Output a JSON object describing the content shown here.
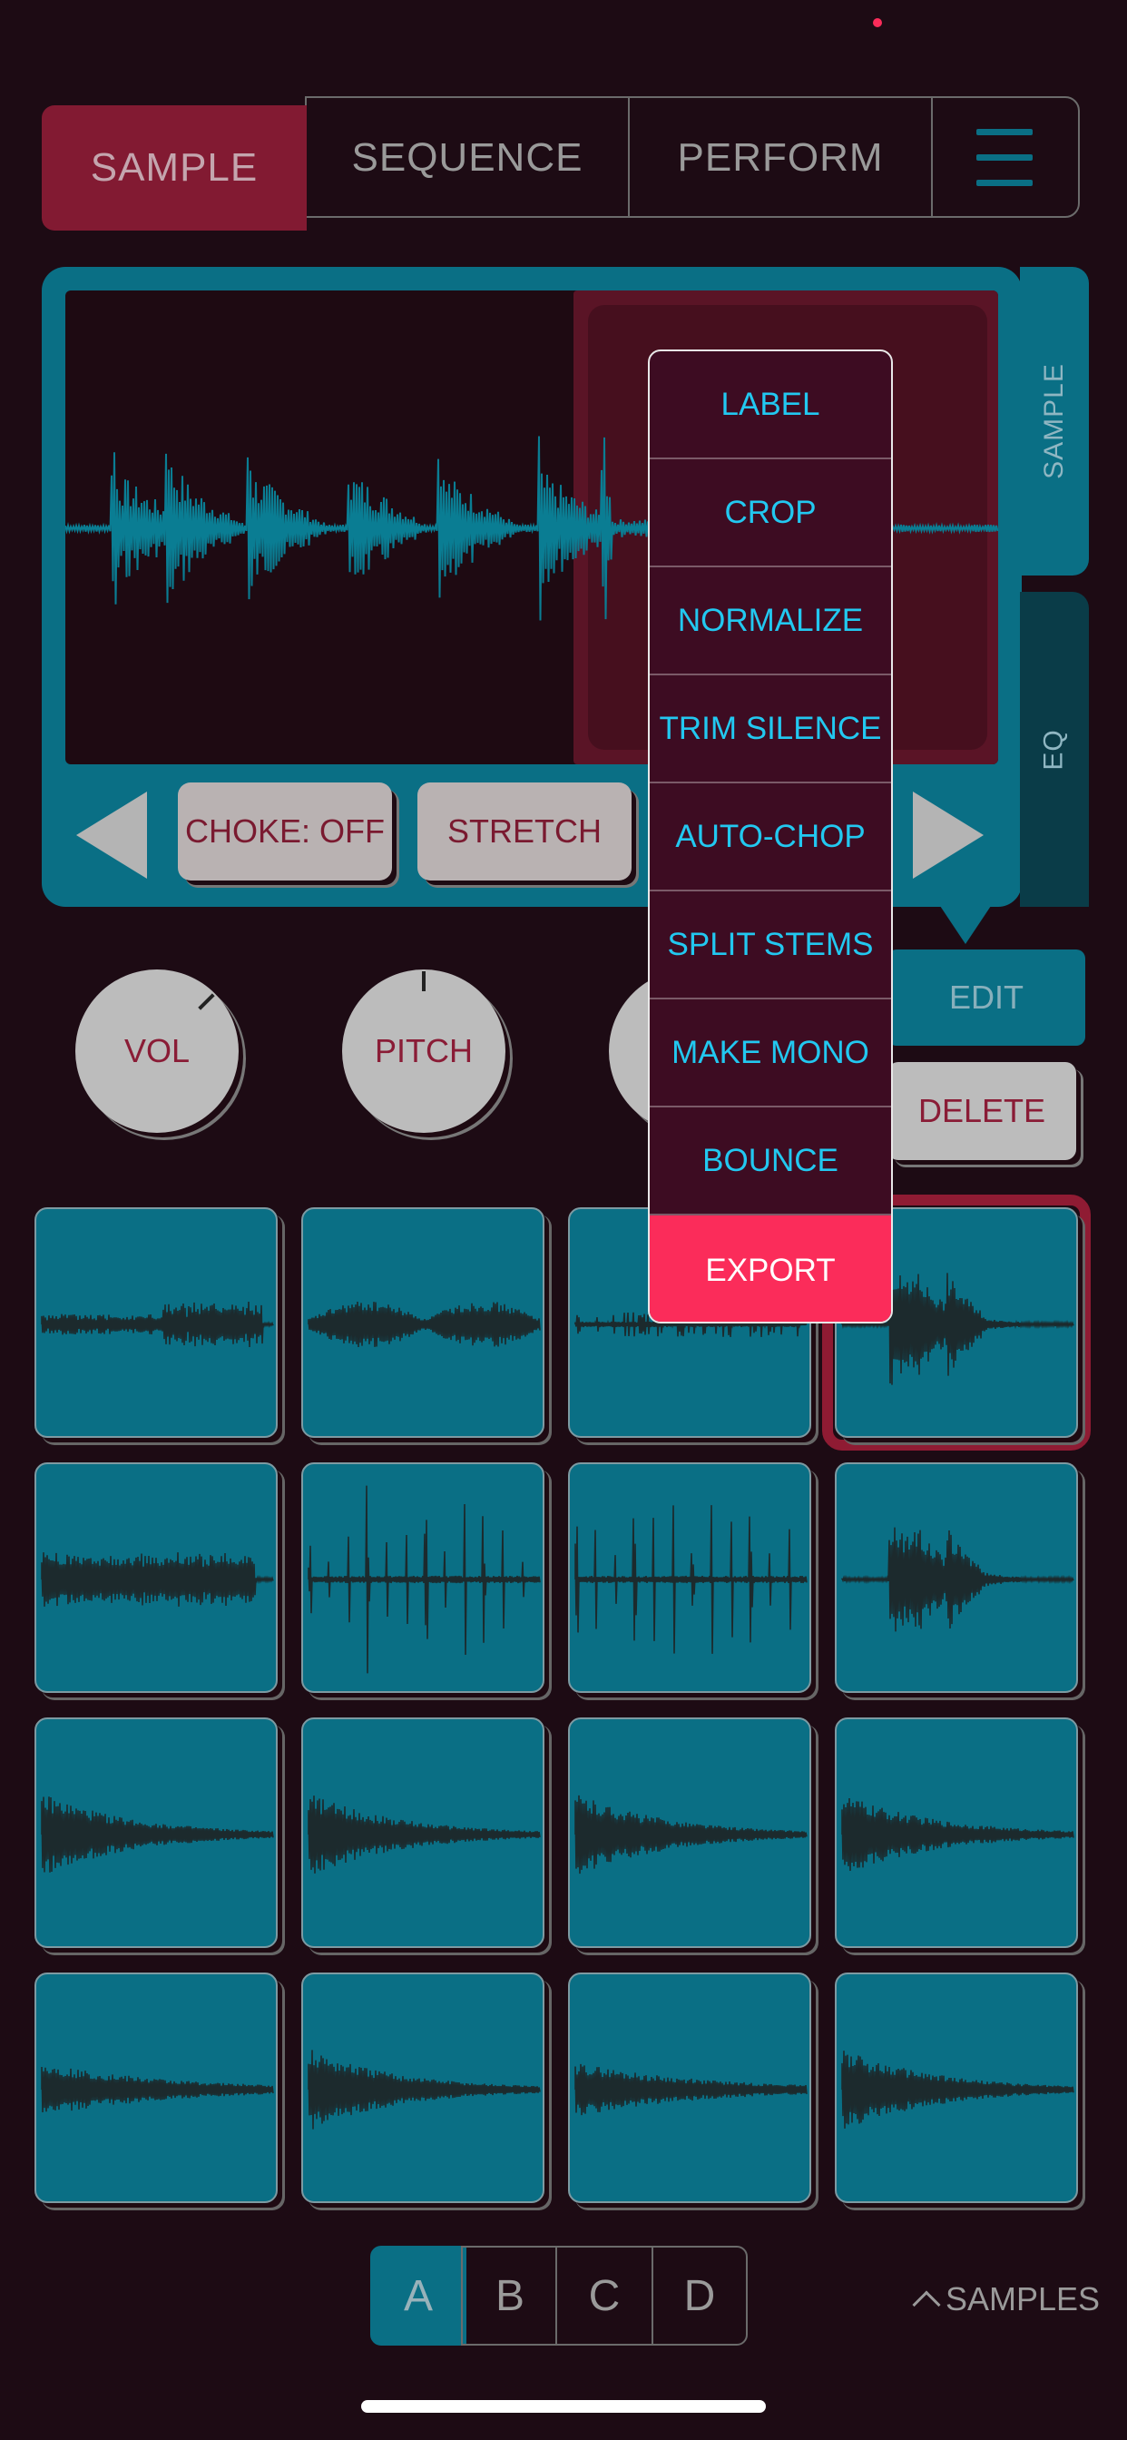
{
  "tabs": {
    "sample": "SAMPLE",
    "sequence": "SEQUENCE",
    "perform": "PERFORM"
  },
  "panel": {
    "side_tabs": {
      "sample": "SAMPLE",
      "eq": "EQ"
    },
    "choke": "CHOKE: OFF",
    "stretch": "STRETCH"
  },
  "knobs": {
    "vol": "VOL",
    "pitch": "PITCH"
  },
  "actions": {
    "edit": "EDIT",
    "delete": "DELETE"
  },
  "menu": {
    "items": [
      "LABEL",
      "CROP",
      "NORMALIZE",
      "TRIM SILENCE",
      "AUTO-CHOP",
      "SPLIT STEMS",
      "MAKE MONO",
      "BOUNCE",
      "EXPORT"
    ]
  },
  "banks": [
    "A",
    "B",
    "C",
    "D"
  ],
  "samples_toggle": "SAMPLES",
  "colors": {
    "accent": "#0a6f85",
    "selection": "#821a32",
    "export": "#fb2c5a",
    "menu_text": "#22c8f0"
  },
  "icons": [
    "hamburger-menu-icon",
    "left-arrow-icon",
    "right-arrow-icon",
    "chevron-up-icon"
  ]
}
